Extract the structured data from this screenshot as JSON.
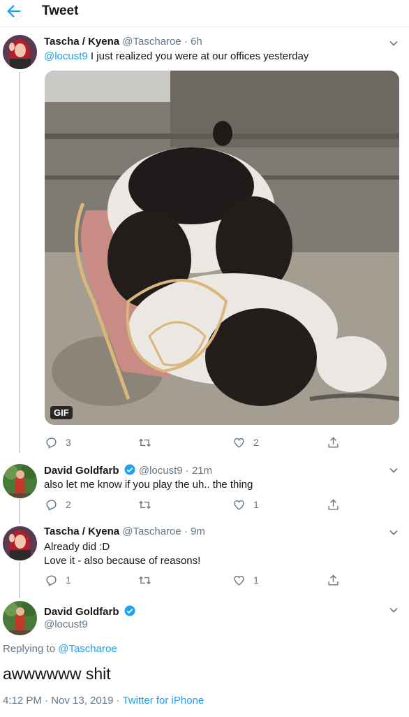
{
  "header": {
    "title": "Tweet"
  },
  "tweets": [
    {
      "display_name": "Tascha / Kyena",
      "handle": "@Tascharoe",
      "separator": "·",
      "time": "6h",
      "mention": "@locust9",
      "text": " I just realized you were at our offices yesterday",
      "media_badge": "GIF",
      "replies": "3",
      "retweets": "",
      "likes": "2"
    },
    {
      "display_name": "David Goldfarb",
      "handle": "@locust9",
      "separator": "·",
      "time": "21m",
      "text": "also let me know if you play the uh.. the thing",
      "replies": "2",
      "retweets": "",
      "likes": "1"
    },
    {
      "display_name": "Tascha / Kyena",
      "handle": "@Tascharoe",
      "separator": "·",
      "time": "9m",
      "text_line1": "Already did :D",
      "text_line2": "Love it - also because of reasons!",
      "replies": "1",
      "retweets": "",
      "likes": "1"
    }
  ],
  "main_tweet": {
    "display_name": "David Goldfarb",
    "handle": "@locust9",
    "replying_prefix": "Replying to ",
    "replying_to": "@Tascharoe",
    "text": "awwwwww shit",
    "time": "4:12 PM",
    "separator1": " · ",
    "date": "Nov 13, 2019",
    "separator2": " · ",
    "source": "Twitter for iPhone"
  },
  "colors": {
    "accent": "#1da1f2",
    "secondary_text": "#657786",
    "thread_line": "#ccd6dd"
  },
  "icons": [
    "back-arrow-icon",
    "chevron-down-icon",
    "reply-icon",
    "retweet-icon",
    "like-icon",
    "share-icon",
    "verified-badge-icon"
  ]
}
